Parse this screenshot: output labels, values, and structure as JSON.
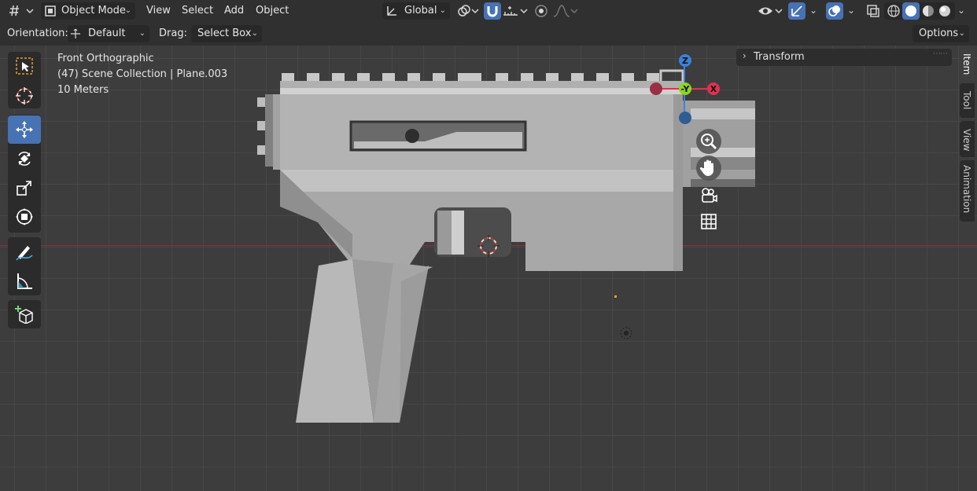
{
  "header": {
    "mode_label": "Object Mode",
    "menu": [
      "View",
      "Select",
      "Add",
      "Object"
    ],
    "transform_orientation": "Global",
    "icons": [
      "editor-type-icon",
      "object-mode-icon",
      "transform-orientation-icon",
      "pivot-icon",
      "snap-icon",
      "snap-increment-icon",
      "proportional-edit-icon",
      "falloff-icon",
      "visibility-icon",
      "gizmo-icon",
      "overlay-icon",
      "xray-icon",
      "wireframe-shading-icon",
      "solid-shading-icon",
      "material-shading-icon",
      "rendered-shading-icon"
    ]
  },
  "tool_header": {
    "orientation_label": "Orientation:",
    "orientation_value": "Default",
    "drag_label": "Drag:",
    "drag_value": "Select Box",
    "options_label": "Options"
  },
  "viewport": {
    "view_name": "Front Orthographic",
    "collection_info": "(47) Scene Collection | Plane.003",
    "scale_info": "10 Meters",
    "colors": {
      "background": "#3d3d3d",
      "grid": "#474747",
      "x_axis_line": "#8a2e3a",
      "active_tool": "#4772b3"
    }
  },
  "toolbar": {
    "tools": [
      "select-box",
      "cursor",
      "move",
      "rotate",
      "scale",
      "transform",
      "annotate",
      "measure",
      "add-cube"
    ],
    "active_tool": "move"
  },
  "nav_gizmo": {
    "axes": {
      "x": "X",
      "y": "-Y",
      "z": "Z"
    },
    "colors": {
      "x": "#e0314f",
      "y": "#8bd81d",
      "z": "#3b83d7"
    },
    "buttons": [
      "zoom-icon",
      "hand-pan-icon",
      "camera-view-icon",
      "ortho-grid-icon"
    ]
  },
  "sidebar": {
    "panel_label": "Transform",
    "tabs": [
      "Item",
      "Tool",
      "View",
      "Animation"
    ],
    "active_tab": "Item"
  }
}
